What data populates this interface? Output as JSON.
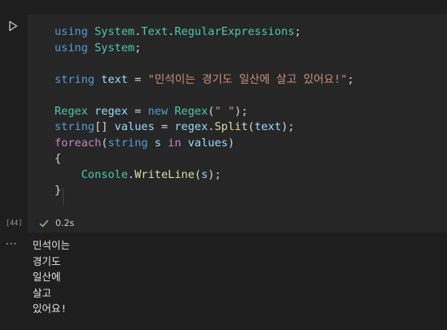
{
  "cell": {
    "execution_count": "[44]",
    "duration": "0.2s",
    "status_color": "#89d185"
  },
  "code_lines": [
    [
      {
        "t": "using",
        "c": "kw"
      },
      {
        "t": " ",
        "c": ""
      },
      {
        "t": "System",
        "c": "ty"
      },
      {
        "t": ".",
        "c": ""
      },
      {
        "t": "Text",
        "c": "ty"
      },
      {
        "t": ".",
        "c": ""
      },
      {
        "t": "RegularExpressions",
        "c": "ty"
      },
      {
        "t": ";",
        "c": ""
      }
    ],
    [
      {
        "t": "using",
        "c": "kw"
      },
      {
        "t": " ",
        "c": ""
      },
      {
        "t": "System",
        "c": "ty"
      },
      {
        "t": ";",
        "c": ""
      }
    ],
    [],
    [
      {
        "t": "string",
        "c": "kw"
      },
      {
        "t": " ",
        "c": ""
      },
      {
        "t": "text",
        "c": "var"
      },
      {
        "t": " = ",
        "c": ""
      },
      {
        "t": "\"민석이는 경기도 일산에 살고 있어요!\"",
        "c": "str"
      },
      {
        "t": ";",
        "c": ""
      }
    ],
    [],
    [
      {
        "t": "Regex",
        "c": "ty"
      },
      {
        "t": " ",
        "c": ""
      },
      {
        "t": "regex",
        "c": "var"
      },
      {
        "t": " = ",
        "c": ""
      },
      {
        "t": "new",
        "c": "kw"
      },
      {
        "t": " ",
        "c": ""
      },
      {
        "t": "Regex",
        "c": "ty"
      },
      {
        "t": "(",
        "c": ""
      },
      {
        "t": "\" \"",
        "c": "str"
      },
      {
        "t": ");",
        "c": ""
      }
    ],
    [
      {
        "t": "string",
        "c": "kw"
      },
      {
        "t": "[] ",
        "c": ""
      },
      {
        "t": "values",
        "c": "var"
      },
      {
        "t": " = ",
        "c": ""
      },
      {
        "t": "regex",
        "c": "var"
      },
      {
        "t": ".",
        "c": ""
      },
      {
        "t": "Split",
        "c": "fn"
      },
      {
        "t": "(",
        "c": ""
      },
      {
        "t": "text",
        "c": "var"
      },
      {
        "t": ");",
        "c": ""
      }
    ],
    [
      {
        "t": "foreach",
        "c": "ctl"
      },
      {
        "t": "(",
        "c": ""
      },
      {
        "t": "string",
        "c": "kw"
      },
      {
        "t": " ",
        "c": ""
      },
      {
        "t": "s",
        "c": "var"
      },
      {
        "t": " ",
        "c": ""
      },
      {
        "t": "in",
        "c": "ctl"
      },
      {
        "t": " ",
        "c": ""
      },
      {
        "t": "values",
        "c": "var"
      },
      {
        "t": ")",
        "c": ""
      }
    ],
    [
      {
        "t": "{",
        "c": ""
      }
    ],
    [
      {
        "t": "    ",
        "c": ""
      },
      {
        "t": "Console",
        "c": "ty"
      },
      {
        "t": ".",
        "c": ""
      },
      {
        "t": "WriteLine",
        "c": "fn"
      },
      {
        "t": "(",
        "c": ""
      },
      {
        "t": "s",
        "c": "var"
      },
      {
        "t": ");",
        "c": ""
      }
    ],
    [
      {
        "t": "}",
        "c": ""
      }
    ]
  ],
  "output_lines": [
    "민석이는",
    "경기도",
    "일산에",
    "살고",
    "있어요!"
  ],
  "icons": {
    "run": "run-triangle-icon",
    "status": "check-icon",
    "output_menu": "more-horizontal-icon"
  },
  "colors": {
    "editor_bg": "#1e1e1e",
    "cell_bg": "#262626",
    "keyword": "#569cd6",
    "type": "#4ec9b0",
    "function": "#dcdcaa",
    "variable": "#9cdcfe",
    "string": "#ce9178",
    "control": "#c586c0"
  }
}
